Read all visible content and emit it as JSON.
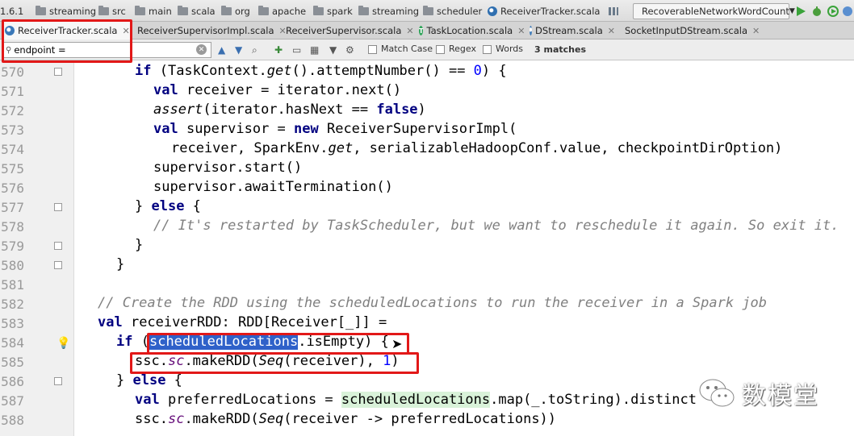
{
  "breadcrumb": {
    "items": [
      {
        "label": "1.6.1",
        "icon": "none"
      },
      {
        "label": "streaming",
        "icon": "folder-icon"
      },
      {
        "label": "src",
        "icon": "folder-icon"
      },
      {
        "label": "main",
        "icon": "folder-icon"
      },
      {
        "label": "scala",
        "icon": "folder-icon"
      },
      {
        "label": "org",
        "icon": "folder-icon"
      },
      {
        "label": "apache",
        "icon": "folder-icon"
      },
      {
        "label": "spark",
        "icon": "folder-icon"
      },
      {
        "label": "streaming",
        "icon": "folder-icon"
      },
      {
        "label": "scheduler",
        "icon": "folder-icon"
      },
      {
        "label": "ReceiverTracker.scala",
        "icon": "scala-file-icon"
      }
    ],
    "run_config": "RecoverableNetworkWordCount"
  },
  "tabs": [
    {
      "label": "ReceiverTracker.scala",
      "active": true,
      "icon": "scala-file-icon"
    },
    {
      "label": "ReceiverSupervisorImpl.scala",
      "active": false,
      "icon": "scala-file-icon"
    },
    {
      "label": "ReceiverSupervisor.scala",
      "active": false,
      "icon": "scala-file-icon"
    },
    {
      "label": "TaskLocation.scala",
      "active": false,
      "icon": "trait-icon"
    },
    {
      "label": "DStream.scala",
      "active": false,
      "icon": "scala-file-icon"
    },
    {
      "label": "SocketInputDStream.scala",
      "active": false,
      "icon": "scala-file-icon"
    }
  ],
  "search": {
    "value": "endpoint =",
    "options": {
      "match_case": "Match Case",
      "regex": "Regex",
      "words": "Words"
    },
    "matches": "3 matches"
  },
  "editor": {
    "line_numbers": [
      "570",
      "571",
      "572",
      "573",
      "574",
      "575",
      "576",
      "577",
      "578",
      "579",
      "580",
      "581",
      "582",
      "583",
      "584",
      "585",
      "586",
      "587",
      "588"
    ]
  },
  "watermark": {
    "text": "数模堂",
    "icon": "wechat-icon"
  },
  "colors": {
    "keyword": "#000080",
    "number": "#0000ff",
    "comment": "#808080",
    "highlight_box": "#e21818"
  }
}
